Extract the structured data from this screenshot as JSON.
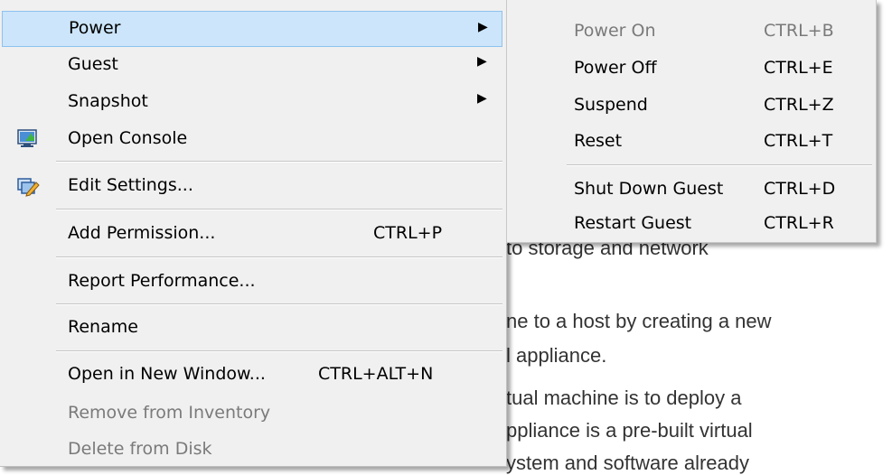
{
  "background_text": [
    "to storage and network",
    "ne to a host by creating a new",
    "l appliance.",
    "tual machine is to deploy a",
    "ppliance is a pre-built virtual",
    "ystem and software already"
  ],
  "context_menu": {
    "items": [
      {
        "label": "Power",
        "submenu": true,
        "arrow": "▶"
      },
      {
        "label": "Guest",
        "submenu": true,
        "arrow": "▶"
      },
      {
        "label": "Snapshot",
        "submenu": true,
        "arrow": "▶"
      },
      {
        "label": "Open Console",
        "icon": "console-icon"
      },
      {
        "label": "Edit Settings...",
        "icon": "edit-settings-icon"
      },
      {
        "label": "Add Permission...",
        "shortcut": "CTRL+P"
      },
      {
        "label": "Report Performance..."
      },
      {
        "label": "Rename"
      },
      {
        "label": "Open in New Window...",
        "shortcut": "CTRL+ALT+N"
      },
      {
        "label": "Remove from Inventory",
        "disabled": true
      },
      {
        "label": "Delete from Disk",
        "disabled": true
      }
    ]
  },
  "power_submenu": {
    "items": [
      {
        "label": "Power On",
        "shortcut": "CTRL+B",
        "disabled": true
      },
      {
        "label": "Power Off",
        "shortcut": "CTRL+E"
      },
      {
        "label": "Suspend",
        "shortcut": "CTRL+Z"
      },
      {
        "label": "Reset",
        "shortcut": "CTRL+T"
      },
      {
        "label": "Shut Down Guest",
        "shortcut": "CTRL+D"
      },
      {
        "label": "Restart Guest",
        "shortcut": "CTRL+R"
      }
    ]
  },
  "colors": {
    "menu_bg": "#f0f0f0",
    "highlight_bg": "#cce5fa",
    "highlight_border": "#8ec2ef",
    "disabled_text": "#7a7a7a",
    "separator": "#c6c6c6"
  }
}
